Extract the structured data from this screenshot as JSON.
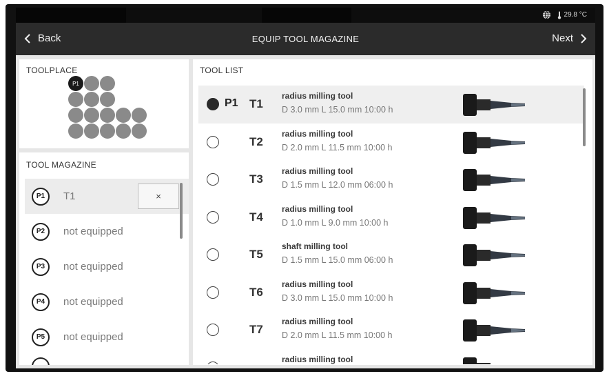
{
  "status": {
    "temperature": "29.8 °C",
    "icon": "globe-icon"
  },
  "nav": {
    "back_label": "Back",
    "title": "EQUIP TOOL MAGAZINE",
    "next_label": "Next"
  },
  "toolplace": {
    "title": "TOOLPLACE",
    "active_label": "P1",
    "rows": [
      3,
      3,
      5,
      5
    ]
  },
  "magazine": {
    "title": "TOOL MAGAZINE",
    "clear_label": "×",
    "items": [
      {
        "badge": "P1",
        "label": "T1"
      },
      {
        "badge": "P2",
        "label": "not equipped"
      },
      {
        "badge": "P3",
        "label": "not equipped"
      },
      {
        "badge": "P4",
        "label": "not equipped"
      },
      {
        "badge": "P5",
        "label": "not equipped"
      }
    ]
  },
  "tool_list": {
    "title": "TOOL LIST",
    "items": [
      {
        "position": "P1",
        "id": "T1",
        "name": "radius milling tool",
        "spec": "D 3.0 mm L 15.0 mm 10:00 h",
        "shank": 0.18,
        "selected": true
      },
      {
        "position": "",
        "id": "T2",
        "name": "radius milling tool",
        "spec": "D 2.0 mm L 11.5 mm 10:00 h",
        "shank": 0.18,
        "selected": false
      },
      {
        "position": "",
        "id": "T3",
        "name": "radius milling tool",
        "spec": "D 1.5 mm L 12.0 mm 06:00 h",
        "shank": 0.18,
        "selected": false
      },
      {
        "position": "",
        "id": "T4",
        "name": "radius milling tool",
        "spec": "D 1.0 mm L 9.0 mm 10:00 h",
        "shank": 0.18,
        "selected": false
      },
      {
        "position": "",
        "id": "T5",
        "name": "shaft milling tool",
        "spec": "D 1.5 mm L 15.0 mm 06:00 h",
        "shank": 0.18,
        "selected": false
      },
      {
        "position": "",
        "id": "T6",
        "name": "radius milling tool",
        "spec": "D 3.0 mm L 15.0 mm 10:00 h",
        "shank": 0.18,
        "selected": false
      },
      {
        "position": "",
        "id": "T7",
        "name": "radius milling tool",
        "spec": "D 2.0 mm L 11.5 mm 10:00 h",
        "shank": 0.18,
        "selected": false
      },
      {
        "position": "",
        "id": "",
        "name": "radius milling tool",
        "spec": "",
        "shank": 0.18,
        "selected": false
      }
    ]
  }
}
